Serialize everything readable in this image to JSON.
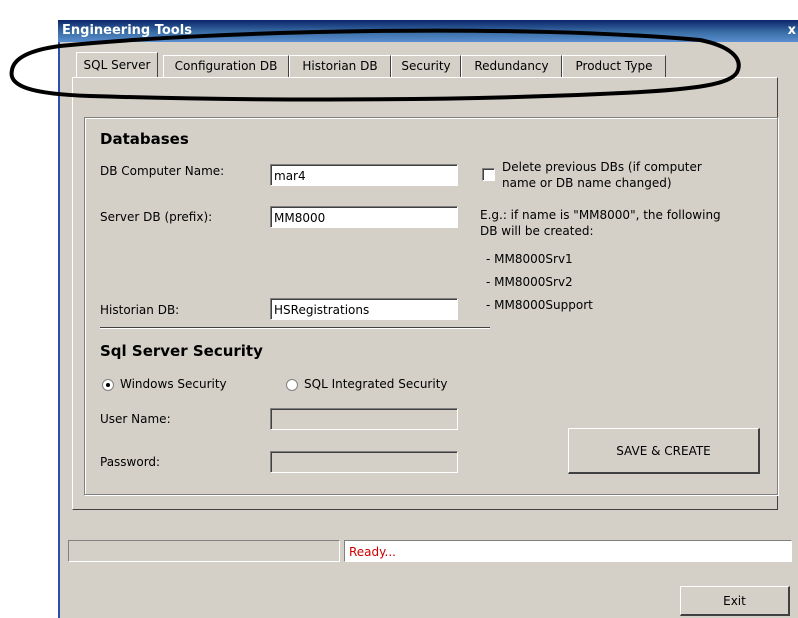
{
  "window": {
    "title": "Engineering Tools",
    "close_glyph": "x"
  },
  "tabs": [
    {
      "label": "SQL Server",
      "active": true
    },
    {
      "label": "Configuration DB"
    },
    {
      "label": "Historian DB"
    },
    {
      "label": "Security"
    },
    {
      "label": "Redundancy"
    },
    {
      "label": "Product Type"
    }
  ],
  "databases": {
    "heading": "Databases",
    "computer_name_label": "DB Computer Name:",
    "computer_name_value": "mar4",
    "server_db_label": "Server DB (prefix):",
    "server_db_value": "MM8000",
    "historian_db_label": "Historian DB:",
    "historian_db_value": "HSRegistrations",
    "delete_prev_label_line1": "Delete previous DBs (if computer",
    "delete_prev_label_line2": "name or DB name changed)",
    "delete_prev_checked": false,
    "example_line1": "E.g.: if name is \"MM8000\", the following",
    "example_line2": "DB will be created:",
    "example_items": [
      "- MM8000Srv1",
      "- MM8000Srv2",
      "- MM8000Support"
    ]
  },
  "security": {
    "heading": "Sql Server Security",
    "windows_label": "Windows Security",
    "sql_label": "SQL Integrated Security",
    "selected": "Windows Security",
    "username_label": "User Name:",
    "username_value": "",
    "password_label": "Password:",
    "password_value": ""
  },
  "buttons": {
    "save_create": "SAVE & CREATE",
    "exit": "Exit"
  },
  "status": {
    "text": "Ready...",
    "text_color": "#cc0000"
  },
  "annotation": {
    "color": "#000000"
  }
}
